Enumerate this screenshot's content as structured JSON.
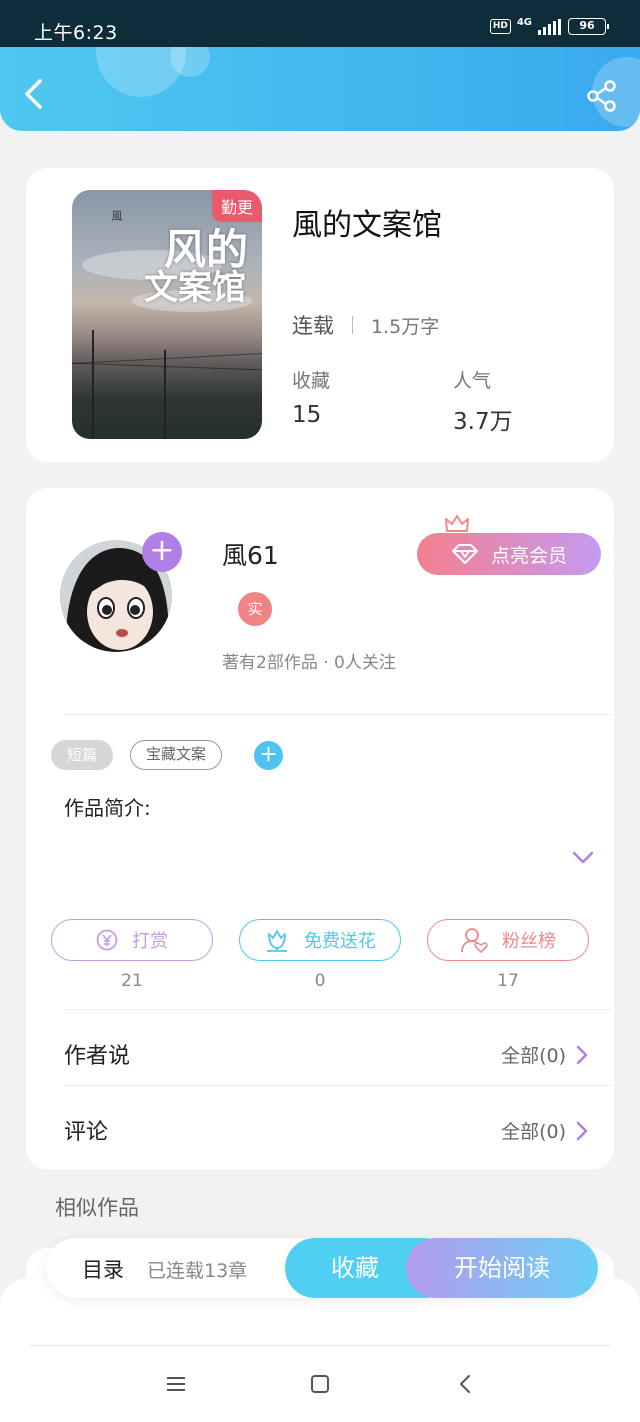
{
  "status_bar": {
    "time": "上午6:23",
    "hd": "HD",
    "network": "4G",
    "battery": "96"
  },
  "book": {
    "cover_tag": "勤更",
    "cover_title_line1": "风的",
    "cover_title_line2": "文案馆",
    "cover_author": "風",
    "title": "風的文案馆",
    "status": "连载",
    "word_count": "1.5万字",
    "stats": [
      {
        "label": "收藏",
        "value": "15"
      },
      {
        "label": "人气",
        "value": "3.7万"
      }
    ]
  },
  "author": {
    "name": "風61",
    "badge": "实",
    "summary": "著有2部作品 · 0人关注",
    "vip_button": "点亮会员"
  },
  "tags": [
    "短篇",
    "宝藏文案"
  ],
  "intro_label": "作品简介:",
  "actions": [
    {
      "label": "打赏",
      "count": "21",
      "color": "#c69be8",
      "icon": "yen-coin-icon"
    },
    {
      "label": "免费送花",
      "count": "0",
      "color": "#4fc8ea",
      "icon": "flower-icon"
    },
    {
      "label": "粉丝榜",
      "count": "17",
      "color": "#ef8a8a",
      "icon": "fan-rank-icon"
    }
  ],
  "rows": [
    {
      "label": "作者说",
      "right": "全部(0)"
    },
    {
      "label": "评论",
      "right": "全部(0)"
    }
  ],
  "similar_title": "相似作品",
  "bottom_bar": {
    "toc": "目录",
    "chapters": "已连载13章",
    "collect": "收藏",
    "read": "开始阅读"
  },
  "colors": {
    "primary": "#3db5ee",
    "purple": "#b27fe6",
    "pink": "#f08484"
  }
}
